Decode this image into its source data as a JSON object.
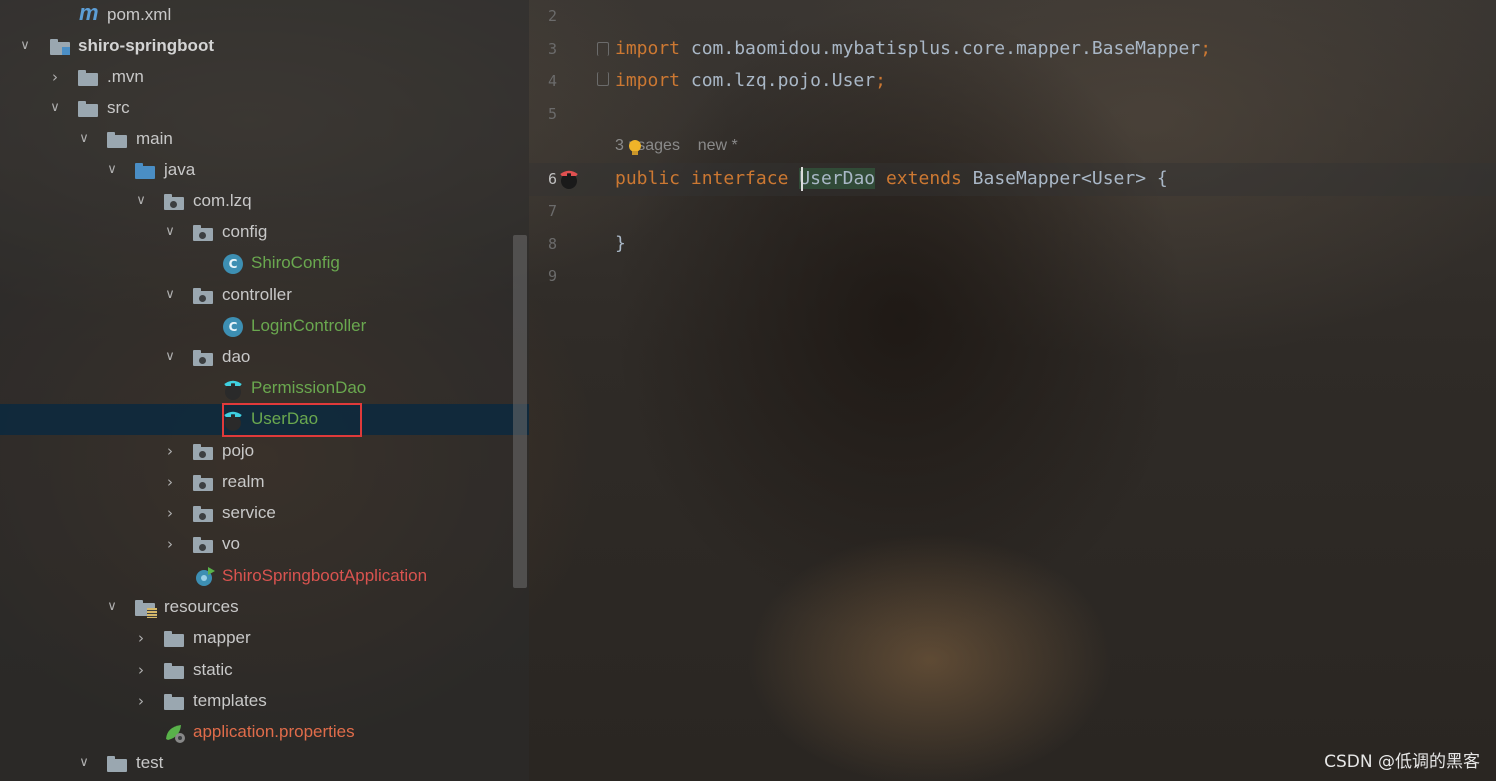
{
  "tree": {
    "items": [
      {
        "label": "pom.xml",
        "kind": "maven-file",
        "color": "#c8c8c8",
        "expanded": null
      },
      {
        "label": "shiro-springboot",
        "kind": "module-folder",
        "color": "#d4d4d4",
        "expanded": true
      },
      {
        "label": ".mvn",
        "kind": "folder",
        "expanded": false
      },
      {
        "label": "src",
        "kind": "folder",
        "expanded": true
      },
      {
        "label": "main",
        "kind": "folder",
        "expanded": true
      },
      {
        "label": "java",
        "kind": "source-folder",
        "expanded": true
      },
      {
        "label": "com.lzq",
        "kind": "package",
        "expanded": true
      },
      {
        "label": "config",
        "kind": "package",
        "expanded": true
      },
      {
        "label": "ShiroConfig",
        "kind": "class",
        "color": "#6aa84f"
      },
      {
        "label": "controller",
        "kind": "package",
        "expanded": true
      },
      {
        "label": "LoginController",
        "kind": "class",
        "color": "#6aa84f"
      },
      {
        "label": "dao",
        "kind": "package",
        "expanded": true
      },
      {
        "label": "PermissionDao",
        "kind": "mapper",
        "color": "#6aa84f"
      },
      {
        "label": "UserDao",
        "kind": "mapper",
        "color": "#6aa84f",
        "selected": true
      },
      {
        "label": "pojo",
        "kind": "package",
        "expanded": false
      },
      {
        "label": "realm",
        "kind": "package",
        "expanded": false
      },
      {
        "label": "service",
        "kind": "package",
        "expanded": false
      },
      {
        "label": "vo",
        "kind": "package",
        "expanded": false
      },
      {
        "label": "ShiroSpringbootApplication",
        "kind": "spring-app",
        "color": "#d9534f"
      },
      {
        "label": "resources",
        "kind": "resources-folder",
        "expanded": true
      },
      {
        "label": "mapper",
        "kind": "folder",
        "expanded": false
      },
      {
        "label": "static",
        "kind": "folder",
        "expanded": false
      },
      {
        "label": "templates",
        "kind": "folder",
        "expanded": false
      },
      {
        "label": "application.properties",
        "kind": "properties-file",
        "color": "#e06c4a"
      },
      {
        "label": "test",
        "kind": "folder",
        "expanded": true
      }
    ]
  },
  "editor": {
    "line_numbers": [
      "2",
      "3",
      "4",
      "5",
      "6",
      "7",
      "8",
      "9"
    ],
    "current_line": "6",
    "lines": {
      "l3_kw": "import",
      "l3_rest": " com.baomidou.mybatisplus.core.mapper.BaseMapper",
      "l3_semi": ";",
      "l4_kw": "import",
      "l4_rest": " com.lzq.pojo.User",
      "l4_semi": ";",
      "hint_usages": "3 usages",
      "hint_new": "new *",
      "l6_kw1": "public",
      "l6_kw2": "interface",
      "l6_cls": "UserDao",
      "l6_kw3": "extends",
      "l6_rest": "BaseMapper<User> {",
      "l8": "}"
    }
  },
  "watermark": "CSDN @低调的黑客",
  "colors": {
    "keyword": "#cc7832",
    "code_text": "#a9b7c6",
    "class_name_green": "#6aa84f",
    "spring_red": "#d9534f",
    "selection_bg": "#0d293e",
    "highlight_box": "#e03a3a"
  }
}
